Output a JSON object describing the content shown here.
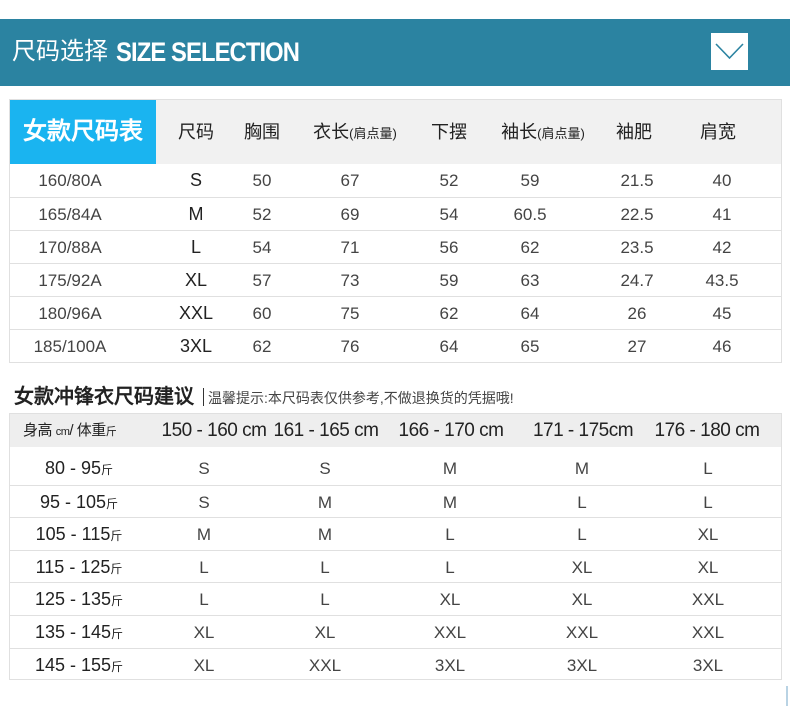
{
  "banner": {
    "title_cn": "尺码选择",
    "title_en": "SIZE SELECTION",
    "icon": "chevron-down-icon"
  },
  "women_size_table": {
    "title": "女款尺码表",
    "headers": [
      "尺码",
      "胸围",
      "衣长",
      "(肩点量)",
      "下摆",
      "袖长",
      "(肩点量)",
      "袖肥",
      "肩宽"
    ],
    "rows": [
      {
        "spec": "160/80A",
        "size": "S",
        "chest": "50",
        "length": "67",
        "hem": "52",
        "sleeve": "59",
        "sleeve_width": "21.5",
        "shoulder": "40"
      },
      {
        "spec": "165/84A",
        "size": "M",
        "chest": "52",
        "length": "69",
        "hem": "54",
        "sleeve": "60.5",
        "sleeve_width": "22.5",
        "shoulder": "41"
      },
      {
        "spec": "170/88A",
        "size": "L",
        "chest": "54",
        "length": "71",
        "hem": "56",
        "sleeve": "62",
        "sleeve_width": "23.5",
        "shoulder": "42"
      },
      {
        "spec": "175/92A",
        "size": "XL",
        "chest": "57",
        "length": "73",
        "hem": "59",
        "sleeve": "63",
        "sleeve_width": "24.7",
        "shoulder": "43.5"
      },
      {
        "spec": "180/96A",
        "size": "XXL",
        "chest": "60",
        "length": "75",
        "hem": "62",
        "sleeve": "64",
        "sleeve_width": "26",
        "shoulder": "45"
      },
      {
        "spec": "185/100A",
        "size": "3XL",
        "chest": "62",
        "length": "76",
        "hem": "64",
        "sleeve": "65",
        "sleeve_width": "27",
        "shoulder": "46"
      }
    ]
  },
  "recommend": {
    "title": "女款冲锋衣尺码建议",
    "tip": "温馨提示:本尺码表仅供参考,不做退换货的凭据哦!",
    "corner_a": "身高",
    "corner_b": "cm",
    "corner_c": "/ 体重",
    "corner_d": "斤",
    "heights": [
      "150 - 160 cm",
      "161 - 165 cm",
      "166 - 170 cm",
      "171 - 175cm",
      "176 - 180 cm"
    ],
    "weight_unit": "斤",
    "rows": [
      {
        "weight": "80 - 95",
        "sizes": [
          "S",
          "S",
          "M",
          "M",
          "L"
        ]
      },
      {
        "weight": "95 - 105",
        "sizes": [
          "S",
          "M",
          "M",
          "L",
          "L"
        ]
      },
      {
        "weight": "105 - 115",
        "sizes": [
          "M",
          "M",
          "L",
          "L",
          "XL"
        ]
      },
      {
        "weight": "115 - 125",
        "sizes": [
          "L",
          "L",
          "L",
          "XL",
          "XL"
        ]
      },
      {
        "weight": "125 - 135",
        "sizes": [
          "L",
          "L",
          "XL",
          "XL",
          "XXL"
        ]
      },
      {
        "weight": "135 - 145",
        "sizes": [
          "XL",
          "XL",
          "XXL",
          "XXL",
          "XXL"
        ]
      },
      {
        "weight": "145 - 155",
        "sizes": [
          "XL",
          "XXL",
          "3XL",
          "3XL",
          "3XL"
        ]
      }
    ]
  },
  "colors": {
    "banner": "#2b83a1",
    "title_cell": "#1ab4f0",
    "header_bg": "#f1f1f1"
  }
}
